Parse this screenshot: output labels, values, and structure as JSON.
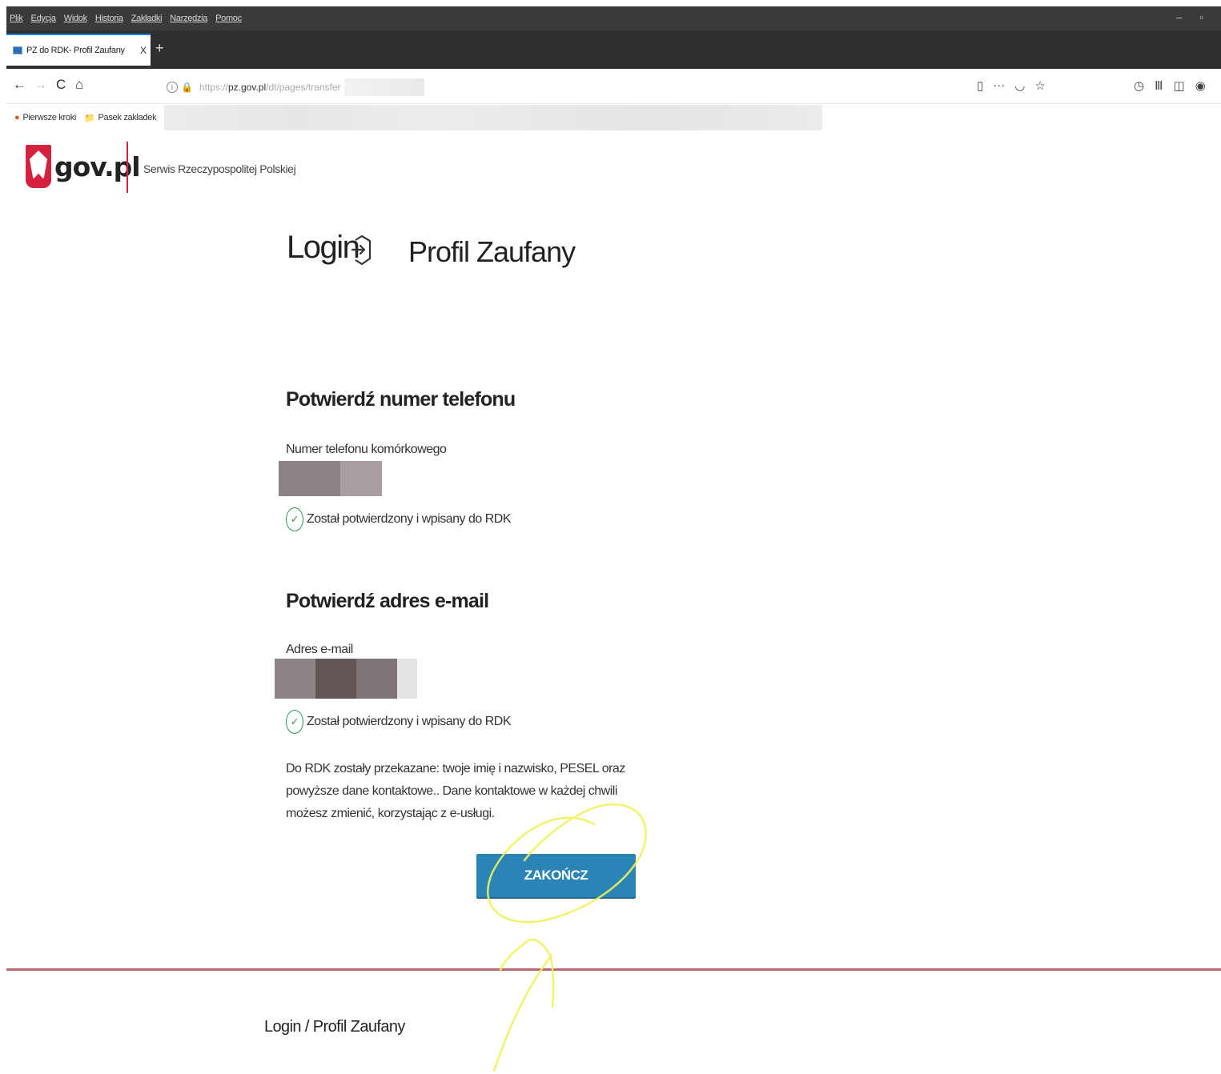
{
  "browser": {
    "menu": [
      "Plik",
      "Edycja",
      "Widok",
      "Historia",
      "Zakładki",
      "Narzędzia",
      "Pomoc"
    ],
    "tab": {
      "title": "PZ do RDK- Profil Zaufany",
      "close": "X"
    },
    "new_tab": "+",
    "url": {
      "scheme": "https://",
      "host": "pz.gov.pl",
      "path": "/dt/pages/transfer"
    },
    "bookmarks": [
      {
        "label": "Pierwsze kroki",
        "icon": "firefox-icon"
      },
      {
        "label": "Pasek zakładek",
        "icon": "folder-icon"
      }
    ],
    "icons": {
      "back": "←",
      "forward": "→",
      "reload": "C",
      "home": "⌂",
      "reader": "▯",
      "more": "···",
      "pocket": "◡",
      "bookmark_star": "☆",
      "history": "◷",
      "library": "Ⅲ",
      "sidebar": "◫",
      "account": "◉",
      "minimize": "–",
      "restore": "▫"
    }
  },
  "header": {
    "brand": "gov.pl",
    "tagline": "Serwis Rzeczypospolitej Polskiej"
  },
  "main": {
    "login_title": "Login",
    "service_title": "Profil Zaufany",
    "phone_section": {
      "heading": "Potwierdź numer telefonu",
      "label": "Numer telefonu komórkowego",
      "status": "Został potwierdzony i wpisany do RDK"
    },
    "email_section": {
      "heading": "Potwierdź adres e-mail",
      "label": "Adres e-mail",
      "status": "Został potwierdzony i wpisany do RDK"
    },
    "info_text": "Do RDK zostały przekazane: twoje imię i nazwisko, PESEL oraz powyższe dane kontaktowe.. Dane kontaktowe w każdej chwili możesz zmienić, korzystając z e-usługi.",
    "finish_button": "ZAKOŃCZ"
  },
  "footer": {
    "link": "Login / Profil Zaufany"
  },
  "colors": {
    "accent_red": "#d4213d",
    "button_blue": "#2a84b5",
    "success_green": "#2e9b4f",
    "annotation_yellow": "#f2f25a"
  }
}
